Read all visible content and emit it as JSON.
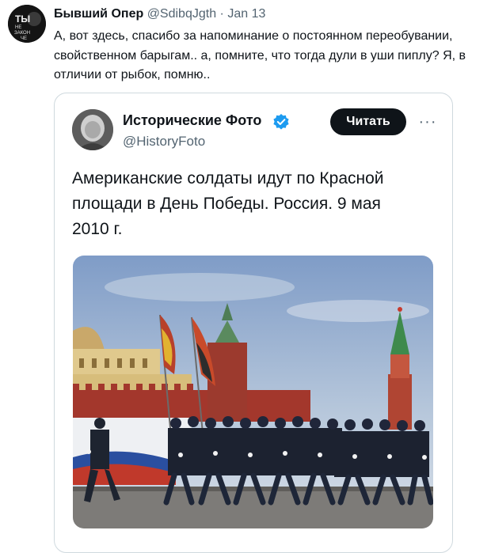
{
  "tweet": {
    "author_name": "Бывший Опер",
    "author_handle": "@SdibqJgth",
    "separator": "·",
    "date": "Jan 13",
    "avatar_text": [
      "ТЫ",
      "НЕ",
      "ЗАКОН",
      "ЧЕ"
    ],
    "text": "А, вот здесь, спасибо за напоминание о постоянном переобувании, свойственном барыгам.. а, помните, что тогда дули в уши пиплу? Я, в отличии от рыбок, помню.."
  },
  "quoted": {
    "author_name": "Исторические Фото",
    "author_handle": "@HistoryFoto",
    "follow_label": "Читать",
    "more_label": "···",
    "text": "Американские солдаты идут по Красной площади в День Победы. Россия. 9 мая 2010 г.",
    "image_icon": "photo-soldiers-red-square"
  },
  "colors": {
    "text": "#0f1419",
    "secondary": "#536471",
    "verified": "#1d9bf0",
    "border": "#cfd9de",
    "button_bg": "#0f1419"
  }
}
